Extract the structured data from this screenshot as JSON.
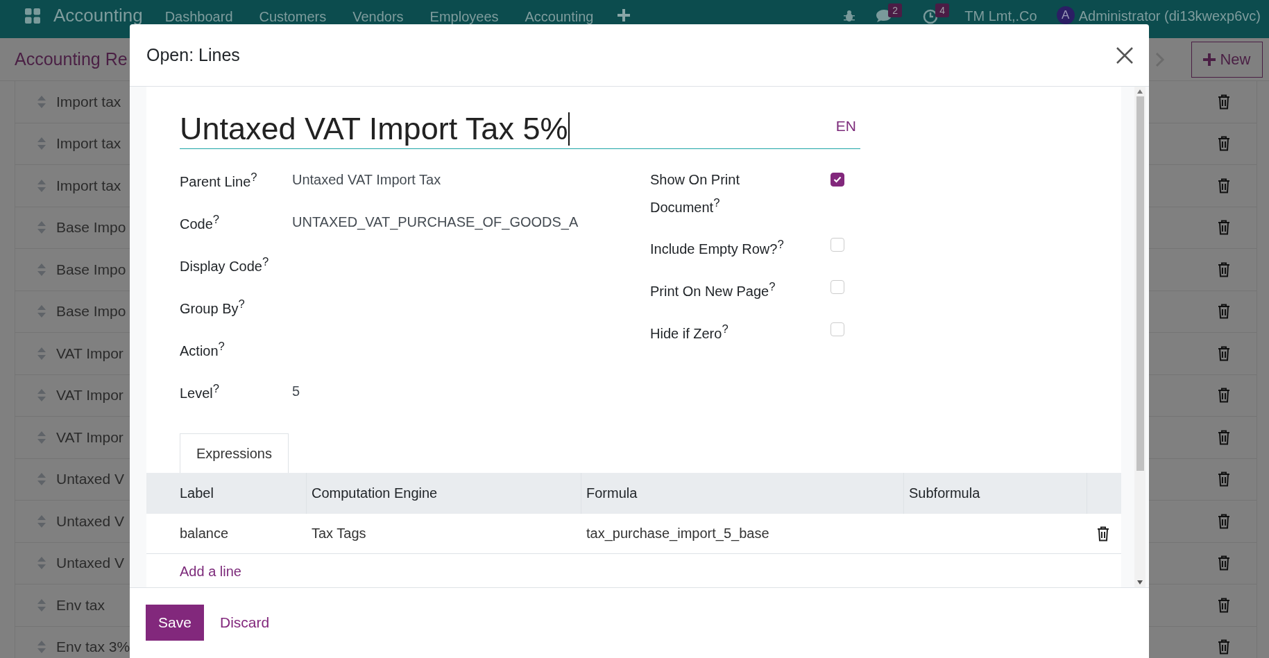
{
  "navbar": {
    "app_name": "Accounting",
    "menu": [
      "Dashboard",
      "Customers",
      "Vendors",
      "Employees",
      "Accounting"
    ],
    "messages_badge": "2",
    "activities_badge": "4",
    "company": "TM Lmt,.Co",
    "avatar_letter": "A",
    "user": "Administrator (di13kwexp6vc)"
  },
  "control_panel": {
    "breadcrumb": "Accounting Re",
    "new_button": "New"
  },
  "background_rows": [
    {
      "label": "Import tax"
    },
    {
      "label": "Import tax"
    },
    {
      "label": "Import tax"
    },
    {
      "label": "Base Impo"
    },
    {
      "label": "Base Impo"
    },
    {
      "label": "Base Impo"
    },
    {
      "label": "VAT Impor"
    },
    {
      "label": "VAT Impor"
    },
    {
      "label": "VAT Impor"
    },
    {
      "label": "Untaxed V"
    },
    {
      "label": "Untaxed V"
    },
    {
      "label": "Untaxed V"
    },
    {
      "label": "Env tax"
    },
    {
      "label": "Env tax 3%"
    }
  ],
  "dialog": {
    "title": "Open: Lines",
    "name": "Untaxed VAT Import Tax 5%",
    "language": "EN",
    "fields": [
      {
        "label": "Parent Line$^{?}$",
        "value": "Untaxed VAT Import Tax"
      },
      {
        "label": "Code$^{?}$",
        "value": "UNTAXED_VAT_PURCHASE_OF_GOODS_A"
      },
      {
        "label": "Display Code$^{?}$"
      },
      {
        "label": "Group By$^{?}$"
      },
      {
        "label": "Action$^{?}$"
      },
      {
        "label": "Level$^{?}$",
        "value": "5"
      }
    ],
    "flags": [
      {
        "label": "Show On Print Document$^{?}$",
        "checked": true
      },
      {
        "label": "Include Empty Row?$^{?}$",
        "checked": false
      },
      {
        "label": "Print On New Page$^{?}$",
        "checked": false
      },
      {
        "label": "Hide if Zero$^{?}$",
        "checked": false
      }
    ],
    "tabs": [
      {
        "label": "Expressions",
        "selected": true
      }
    ],
    "table": {
      "columns": [
        "Label",
        "Computation Engine",
        "Formula",
        "Subformula"
      ],
      "rows": [
        {
          "cells": [
            "balance",
            "Tax Tags",
            "tax_purchase_import_5_base",
            ""
          ]
        }
      ]
    },
    "add_line": "Add a line",
    "buttons": {
      "save": "Save",
      "discard": "Discard"
    }
  }
}
